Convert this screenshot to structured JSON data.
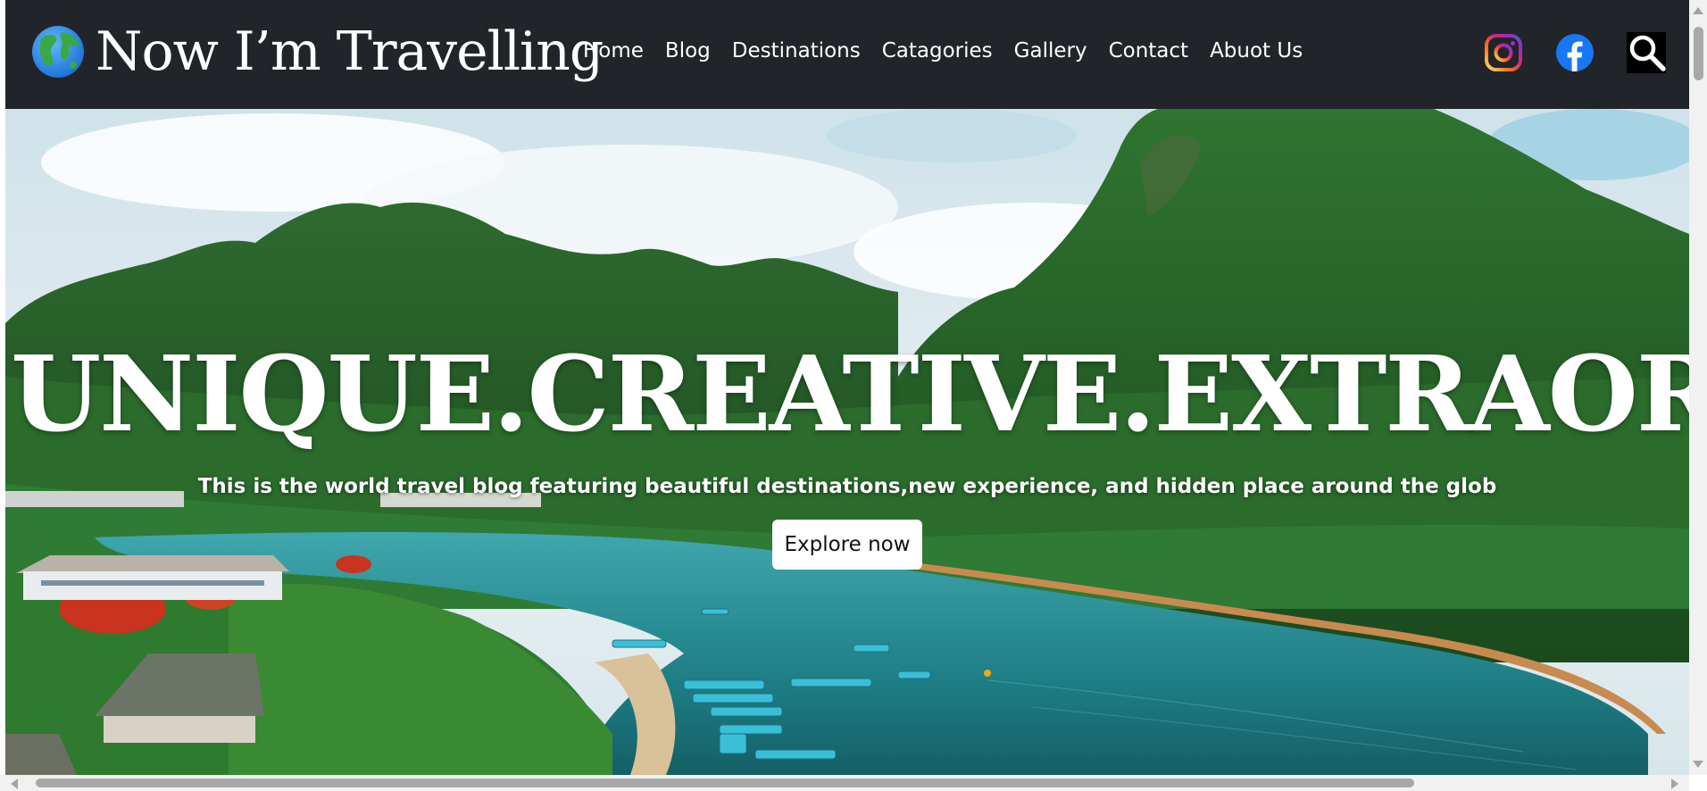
{
  "header": {
    "brand_icon": "globe-icon",
    "brand_title": "Now I’m Travelling",
    "nav": [
      {
        "label": "Home"
      },
      {
        "label": "Blog"
      },
      {
        "label": "Destinations"
      },
      {
        "label": "Catagories"
      },
      {
        "label": "Gallery"
      },
      {
        "label": "Contact"
      },
      {
        "label": "Abuot Us"
      }
    ],
    "social": {
      "instagram_icon": "instagram-icon",
      "facebook_icon": "facebook-icon",
      "search_icon": "search-icon"
    }
  },
  "hero": {
    "headline": "UNIQUE.CREATIVE.EXTRAORDI",
    "subtitle": "This is the world travel blog featuring beautiful destinations,new experience, and hidden place around the glob",
    "cta_label": "Explore now"
  },
  "colors": {
    "navbar_bg": "#212428",
    "nav_text": "#ffffff",
    "facebook_blue": "#1877f2",
    "instagram_gradient": [
      "#feda75",
      "#fa7e1e",
      "#d62976",
      "#962fbf",
      "#4f5bd5"
    ]
  }
}
